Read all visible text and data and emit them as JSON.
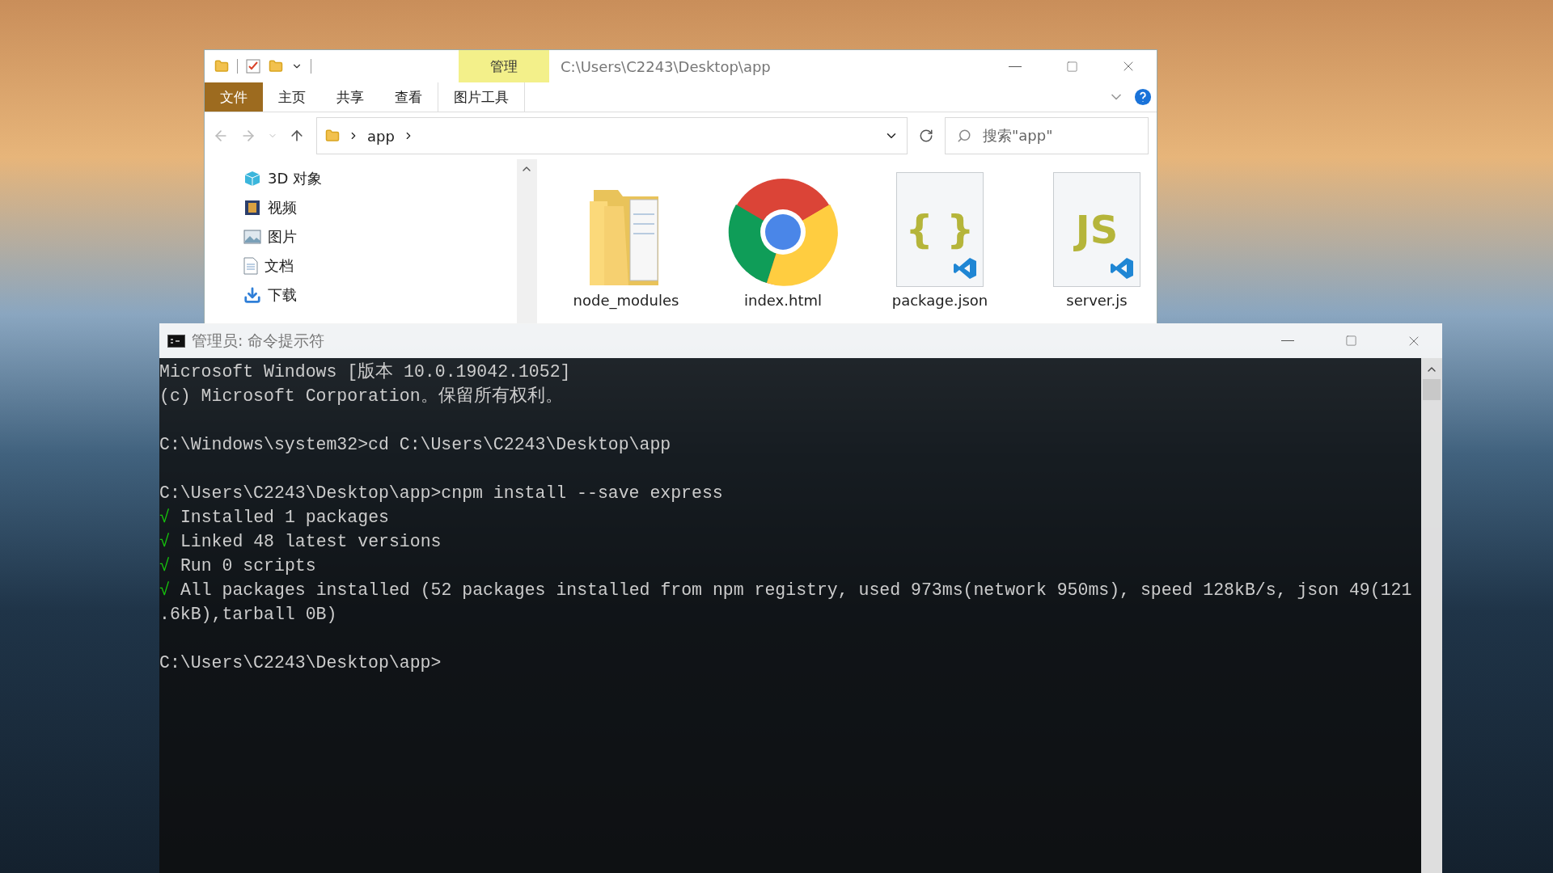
{
  "explorer": {
    "context_group": "管理",
    "path_title": "C:\\Users\\C2243\\Desktop\\app",
    "ribbon_tabs": [
      {
        "label": "文件",
        "kind": "file"
      },
      {
        "label": "主页",
        "kind": "tab"
      },
      {
        "label": "共享",
        "kind": "tab"
      },
      {
        "label": "查看",
        "kind": "tab"
      },
      {
        "label": "图片工具",
        "kind": "context"
      }
    ],
    "breadcrumb": [
      "app"
    ],
    "search": {
      "placeholder": "搜索\"app\""
    },
    "nav_items": [
      {
        "label": "3D 对象",
        "kind": "cube"
      },
      {
        "label": "视频",
        "kind": "film"
      },
      {
        "label": "图片",
        "kind": "picture"
      },
      {
        "label": "文档",
        "kind": "document"
      },
      {
        "label": "下载",
        "kind": "download"
      }
    ],
    "files": [
      {
        "name": "node_modules",
        "kind": "folder"
      },
      {
        "name": "index.html",
        "kind": "browser"
      },
      {
        "name": "package.json",
        "kind": "code",
        "icon_text": "{ }"
      },
      {
        "name": "server.js",
        "kind": "code",
        "icon_text": "JS"
      }
    ]
  },
  "console": {
    "title": "管理员: 命令提示符",
    "lines": [
      {
        "kind": "text",
        "text": "Microsoft Windows [版本 10.0.19042.1052]"
      },
      {
        "kind": "text",
        "text": "(c) Microsoft Corporation。保留所有权利。"
      },
      {
        "kind": "blank"
      },
      {
        "kind": "text",
        "text": "C:\\Windows\\system32>cd C:\\Users\\C2243\\Desktop\\app"
      },
      {
        "kind": "blank"
      },
      {
        "kind": "text",
        "text": "C:\\Users\\C2243\\Desktop\\app>cnpm install --save express"
      },
      {
        "kind": "ok",
        "mark": "√",
        "text": "Installed 1 packages"
      },
      {
        "kind": "ok",
        "mark": "√",
        "text": "Linked 48 latest versions"
      },
      {
        "kind": "ok",
        "mark": "√",
        "text": "Run 0 scripts"
      },
      {
        "kind": "ok",
        "mark": "√",
        "text": "All packages installed (52 packages installed from npm registry, used 973ms(network 950ms), speed 128kB/s, json 49(121"
      },
      {
        "kind": "text",
        "text": ".6kB),tarball 0B)"
      },
      {
        "kind": "blank"
      },
      {
        "kind": "text",
        "text": "C:\\Users\\C2243\\Desktop\\app>"
      }
    ]
  }
}
